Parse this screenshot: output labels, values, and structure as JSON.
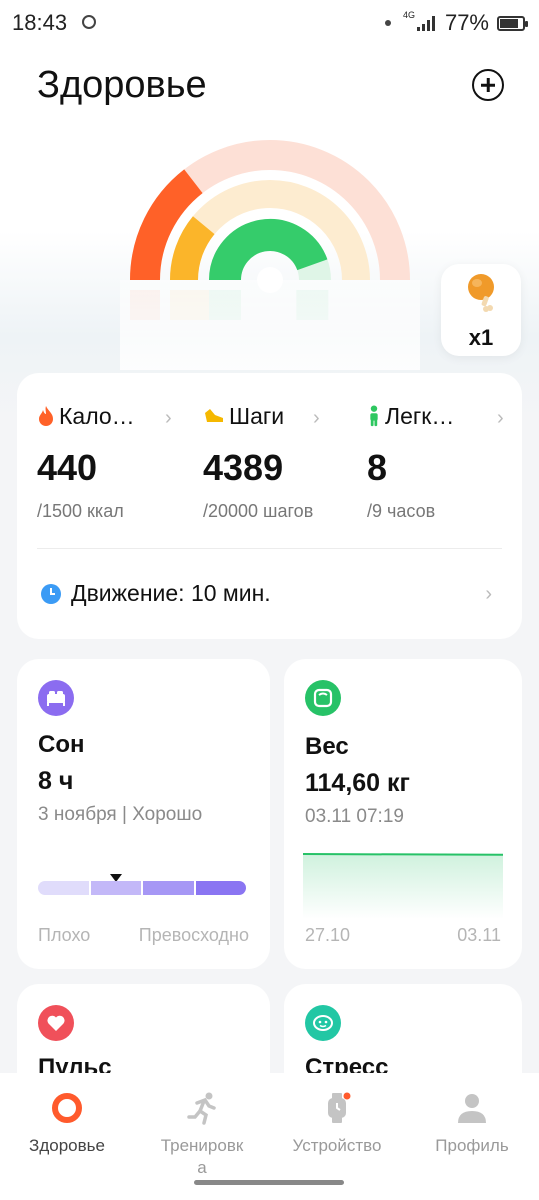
{
  "status_bar": {
    "time": "18:43",
    "network": "4G",
    "battery_percent": "77%",
    "battery_level": 0.77,
    "icons": [
      "ring-indicator-icon",
      "dot-icon",
      "signal-icon",
      "battery-icon"
    ]
  },
  "header": {
    "title": "Здоровье",
    "add_icon": "plus-circle-icon"
  },
  "gauge": {
    "icons": [
      "activity-rings-gauge"
    ],
    "rings": [
      {
        "name": "calories",
        "color": "#ff6128",
        "track": "#fde0d6",
        "fraction": 0.29
      },
      {
        "name": "steps",
        "color": "#fbb52a",
        "track": "#fdecd0",
        "fraction": 0.22
      },
      {
        "name": "standing",
        "color": "#35cc6b",
        "track": "#dff5e7",
        "fraction": 0.89
      }
    ]
  },
  "food_badge": {
    "icon": "chicken-leg-icon",
    "count": "x1"
  },
  "summary": {
    "metrics": [
      {
        "label": "Кало…",
        "value": "440",
        "goal": "/1500 ккал",
        "icon": "flame-icon",
        "color": "#ff6128"
      },
      {
        "label": "Шаги",
        "value": "4389",
        "goal": "/20000 шагов",
        "icon": "shoe-icon",
        "color": "#f5b800"
      },
      {
        "label": "Легк…",
        "value": "8",
        "goal": "/9 часов",
        "icon": "person-standing-icon",
        "color": "#2ec760"
      }
    ],
    "movement": "Движение: 10 мин.",
    "movement_icon": "clock-icon",
    "chevron_icon": "chevron-right-icon"
  },
  "sleep": {
    "icon": "bed-icon",
    "icon_color": "#8b6cf0",
    "title": "Сон",
    "value": "8 ч",
    "subtitle": "3 ноября | Хорошо",
    "scale": [
      "Плохо",
      "Превосходно"
    ],
    "marker_position": 0.375,
    "segment_colors": [
      "#e0dcfb",
      "#c3b8f8",
      "#a697f5",
      "#8a75f2"
    ]
  },
  "weight": {
    "icon": "scale-icon",
    "icon_color": "#27c267",
    "title": "Вес",
    "value": "114,60 кг",
    "subtitle": "03.11 07:19",
    "x_labels": [
      "27.10",
      "03.11"
    ],
    "line_color": "#27c267"
  },
  "pulse": {
    "icon": "heart-icon",
    "icon_color": "#f0505a",
    "title": "Пульс"
  },
  "stress": {
    "icon": "face-icon",
    "icon_color": "#22c7a4",
    "title": "Стресс"
  },
  "nav": {
    "items": [
      {
        "label": "Здоровье",
        "icon": "health-ring-icon",
        "active": true
      },
      {
        "label": "Тренировк а",
        "icon": "running-icon",
        "active": false
      },
      {
        "label": "Устройство",
        "icon": "watch-icon",
        "active": false
      },
      {
        "label": "Профиль",
        "icon": "profile-icon",
        "active": false
      }
    ],
    "accent": "#ff5a2c"
  }
}
